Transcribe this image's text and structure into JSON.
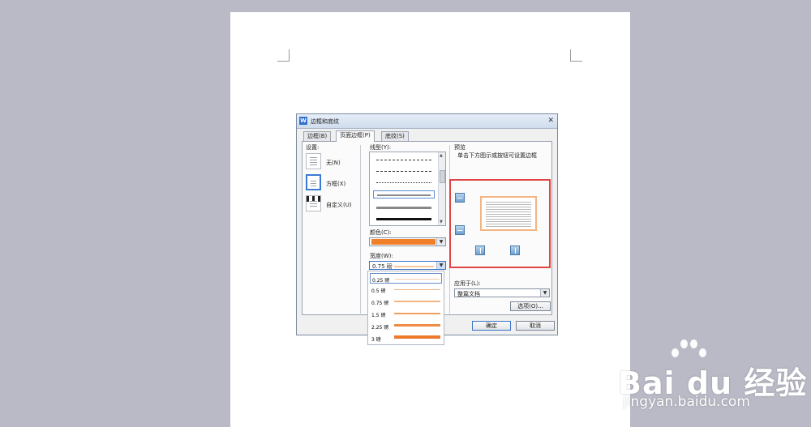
{
  "dialog": {
    "title": "边框和底纹",
    "app_icon": "W",
    "close_glyph": "✕",
    "tabs": [
      "边框(B)",
      "页面边框(P)",
      "底纹(S)"
    ]
  },
  "settings": {
    "label": "设置:",
    "items": [
      "无(N)",
      "方框(X)",
      "自定义(U)"
    ]
  },
  "line_style": {
    "label": "线型(Y):"
  },
  "color": {
    "label": "颜色(C):",
    "value": "#f07f2a"
  },
  "width": {
    "label": "宽度(W):",
    "value": "0.75 磅",
    "options": [
      "0.25 磅",
      "0.5  磅",
      "0.75 磅",
      "1.5  磅",
      "2.25 磅",
      "3    磅"
    ]
  },
  "preview": {
    "label": "预览",
    "hint": "单击下方图示或按钮可设置边框"
  },
  "apply": {
    "label": "应用于(L):",
    "value": "整篇文档",
    "options_button": "选项(O)..."
  },
  "buttons": {
    "ok": "确定",
    "cancel": "取消"
  },
  "watermark": {
    "logo_text": "Bai du 经验",
    "url": "jingyan.baidu.com"
  },
  "colors": {
    "accent_orange": "#f07f2a",
    "highlight_red": "#e04545"
  }
}
